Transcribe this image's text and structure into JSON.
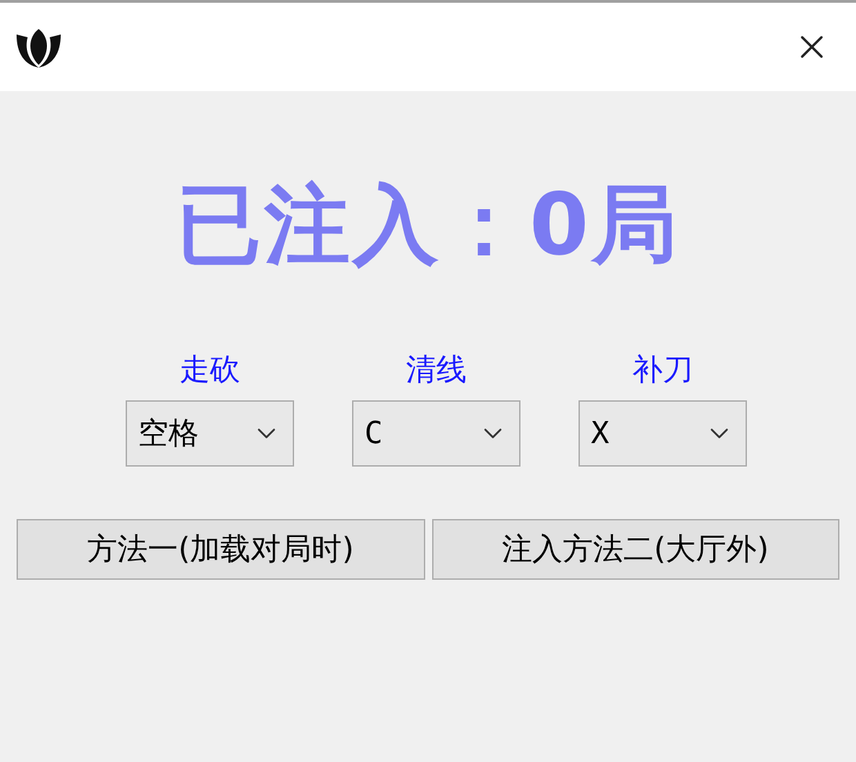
{
  "status": {
    "text": "已注入：0局"
  },
  "hotkeys": [
    {
      "label": "走砍",
      "value": "空格"
    },
    {
      "label": "清线",
      "value": "C"
    },
    {
      "label": "补刀",
      "value": "X"
    }
  ],
  "buttons": [
    "方法一(加载对局时)",
    "注入方法二(大厅外)"
  ]
}
